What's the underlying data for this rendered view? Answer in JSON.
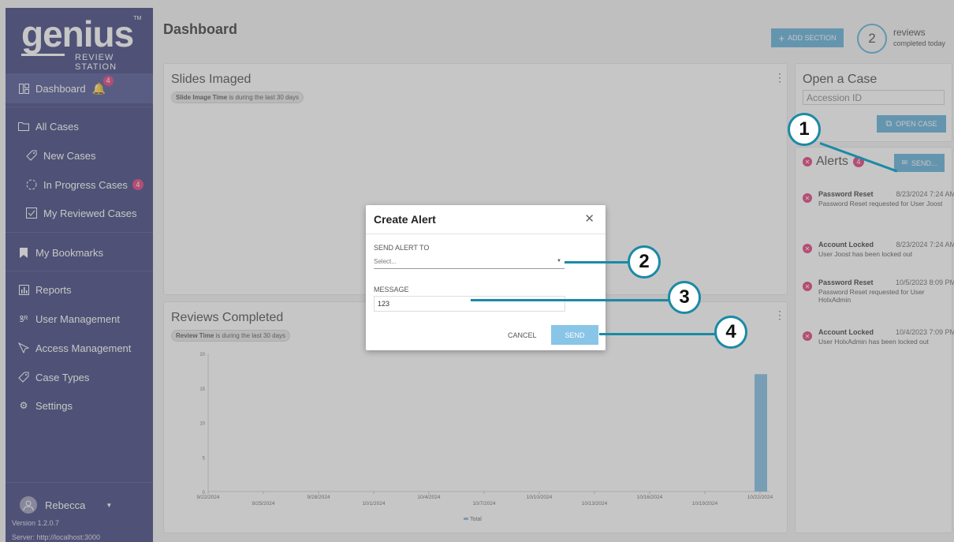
{
  "sidebar": {
    "logo_word": "genius",
    "logo_tm": "TM",
    "logo_sub": "REVIEW STATION",
    "items": [
      {
        "label": "Dashboard",
        "icon": "grid-icon",
        "badge": "4"
      },
      {
        "label": "All Cases",
        "icon": "folder-icon"
      },
      {
        "label": "New Cases",
        "icon": "tag-icon"
      },
      {
        "label": "In Progress Cases",
        "icon": "progress-circle-icon",
        "badge": "4"
      },
      {
        "label": "My Reviewed Cases",
        "icon": "checkbox-icon"
      },
      {
        "label": "My Bookmarks",
        "icon": "bookmark-icon"
      },
      {
        "label": "Reports",
        "icon": "bar-chart-icon"
      },
      {
        "label": "User Management",
        "icon": "users-icon"
      },
      {
        "label": "Access Management",
        "icon": "key-icon"
      },
      {
        "label": "Case Types",
        "icon": "tag-icon"
      },
      {
        "label": "Settings",
        "icon": "gear-icon"
      }
    ],
    "user_name": "Rebecca",
    "version": "Version 1.2.0.7",
    "server": "Server: http://localhost:3000"
  },
  "header": {
    "title": "Dashboard",
    "add_section_label": "ADD SECTION",
    "reviews_count": "2",
    "reviews_label": "reviews",
    "reviews_sub": "completed today"
  },
  "slides_card": {
    "title": "Slides Imaged",
    "pill_bold": "Slide Image Time",
    "pill_text": " is during the last 30 days"
  },
  "reviews_card": {
    "title": "Reviews Completed",
    "pill_bold": "Review Time",
    "pill_text": " is during the last 30 days"
  },
  "open_case": {
    "title": "Open a Case",
    "placeholder": "Accession ID",
    "button_label": "OPEN CASE"
  },
  "alerts": {
    "title": "Alerts",
    "badge": "4",
    "send_label": "SEND...",
    "items": [
      {
        "title": "Password Reset",
        "time": "8/23/2024 7:24 AM",
        "body": "Password Reset requested for User Joost"
      },
      {
        "title": "Account Locked",
        "time": "8/23/2024 7:24 AM",
        "body": "User Joost has been locked out"
      },
      {
        "title": "Password Reset",
        "time": "10/5/2023 8:09 PM",
        "body": "Password Reset requested for User HolxAdmin"
      },
      {
        "title": "Account Locked",
        "time": "10/4/2023 7:09 PM",
        "body": "User HolxAdmin has been locked out"
      }
    ]
  },
  "modal": {
    "title": "Create Alert",
    "send_to_label": "SEND ALERT TO",
    "select_placeholder": "Select...",
    "message_label": "MESSAGE",
    "message_value": "123",
    "cancel_label": "CANCEL",
    "send_label": "SEND"
  },
  "callouts": [
    "1",
    "2",
    "3",
    "4"
  ],
  "colors": {
    "sidebar": "#272d6e",
    "accent": "#4ea6d6",
    "badge": "#e0246a",
    "callout": "#1a8aa6"
  },
  "chart_data": {
    "type": "bar",
    "x": [
      "9/22/2024",
      "9/25/2024",
      "9/28/2024",
      "10/1/2024",
      "10/4/2024",
      "10/7/2024",
      "10/10/2024",
      "10/13/2024",
      "10/16/2024",
      "10/19/2024",
      "10/22/2024"
    ],
    "ylim": [
      0,
      20
    ],
    "yticks": [
      0,
      5,
      10,
      15,
      20
    ],
    "series": [
      {
        "name": "Total",
        "points": [
          {
            "x": "10/22/2024",
            "y": 17
          }
        ]
      }
    ],
    "legend": "bottom"
  }
}
